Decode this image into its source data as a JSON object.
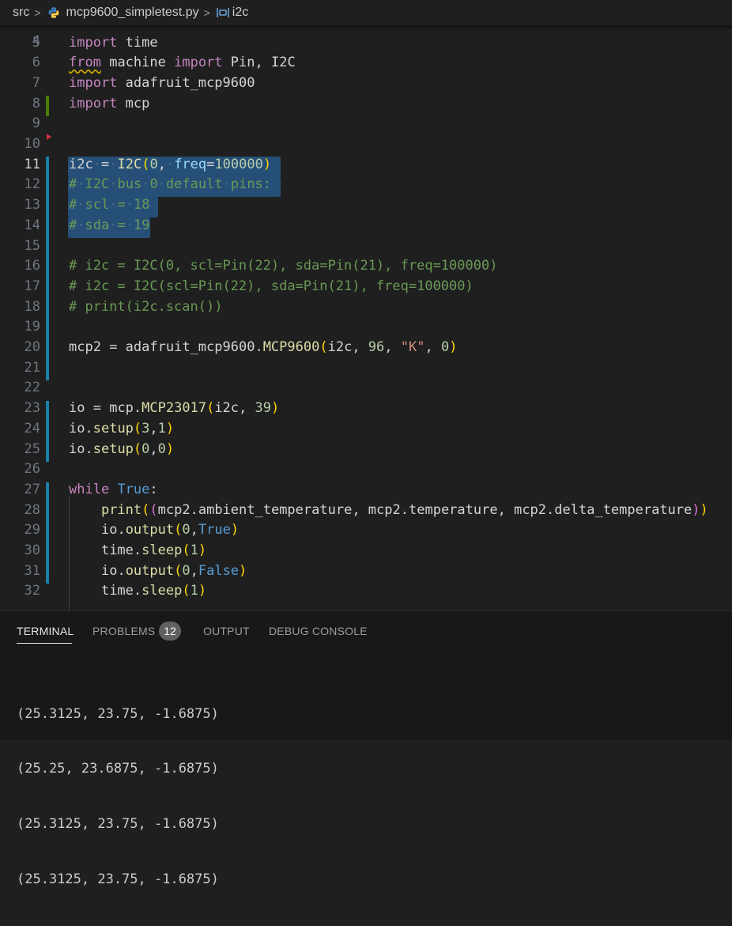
{
  "breadcrumb": {
    "folder": "src",
    "file": "mcp9600_simpletest.py",
    "symbol": "i2c",
    "separator": ">"
  },
  "editor": {
    "partial_line_number": "4",
    "lines": [
      {
        "n": "5",
        "text": "import time"
      },
      {
        "n": "6",
        "text": "from machine import Pin, I2C"
      },
      {
        "n": "7",
        "text": "import adafruit_mcp9600"
      },
      {
        "n": "8",
        "text": "import mcp"
      },
      {
        "n": "9",
        "text": ""
      },
      {
        "n": "10",
        "text": ""
      },
      {
        "n": "11",
        "text": "i2c = I2C(0, freq=100000)"
      },
      {
        "n": "12",
        "text": "# I2C bus 0 default pins:"
      },
      {
        "n": "13",
        "text": "# scl = 18"
      },
      {
        "n": "14",
        "text": "# sda = 19"
      },
      {
        "n": "15",
        "text": ""
      },
      {
        "n": "16",
        "text": "# i2c = I2C(0, scl=Pin(22), sda=Pin(21), freq=100000)"
      },
      {
        "n": "17",
        "text": "# i2c = I2C(scl=Pin(22), sda=Pin(21), freq=100000)"
      },
      {
        "n": "18",
        "text": "# print(i2c.scan())"
      },
      {
        "n": "19",
        "text": ""
      },
      {
        "n": "20",
        "text": "mcp2 = adafruit_mcp9600.MCP9600(i2c, 96, \"K\", 0)"
      },
      {
        "n": "21",
        "text": ""
      },
      {
        "n": "22",
        "text": ""
      },
      {
        "n": "23",
        "text": "io = mcp.MCP23017(i2c, 39)"
      },
      {
        "n": "24",
        "text": "io.setup(3,1)"
      },
      {
        "n": "25",
        "text": "io.setup(0,0)"
      },
      {
        "n": "26",
        "text": ""
      },
      {
        "n": "27",
        "text": "while True:"
      },
      {
        "n": "28",
        "text": "    print((mcp2.ambient_temperature, mcp2.temperature, mcp2.delta_temperature))"
      },
      {
        "n": "29",
        "text": "    io.output(0,True)"
      },
      {
        "n": "30",
        "text": "    time.sleep(1)"
      },
      {
        "n": "31",
        "text": "    io.output(0,False)"
      },
      {
        "n": "32",
        "text": "    time.sleep(1)"
      }
    ]
  },
  "panel": {
    "tabs": {
      "terminal": "TERMINAL",
      "problems": "PROBLEMS",
      "problems_count": "12",
      "output": "OUTPUT",
      "debug_console": "DEBUG CONSOLE"
    },
    "terminal_lines": [
      "(25.3125, 23.75, -1.6875)",
      "(25.25, 23.6875, -1.6875)",
      "(25.3125, 23.75, -1.6875)",
      "(25.3125, 23.75, -1.6875)"
    ]
  },
  "colors": {
    "keyword": "#c586c0",
    "function": "#dcdcaa",
    "number": "#b5cea8",
    "string": "#ce9178",
    "comment": "#6a9955",
    "selection": "#264f78",
    "gutter_modified": "#1b81a8",
    "gutter_added": "#487e02"
  }
}
